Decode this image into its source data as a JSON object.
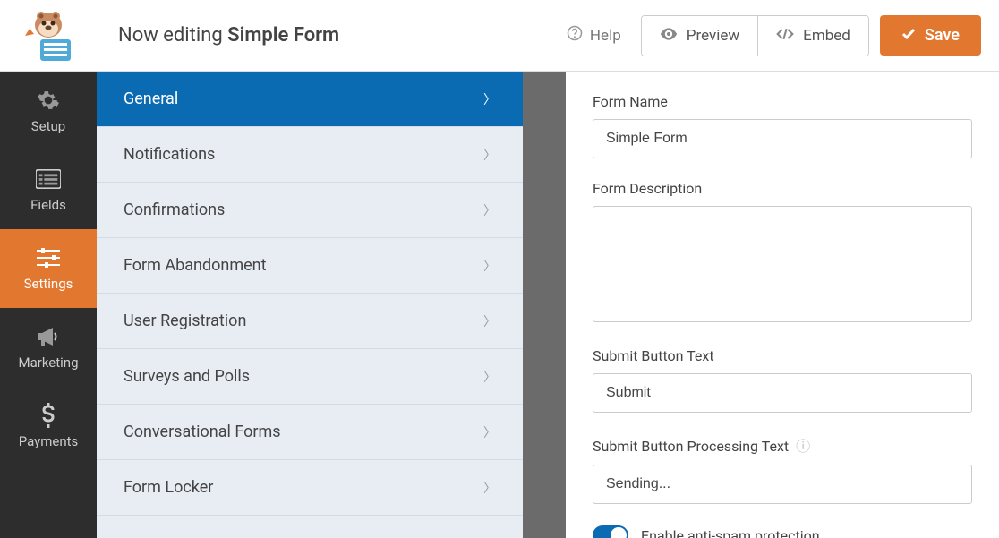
{
  "header": {
    "title_prefix": "Now editing ",
    "form_name": "Simple Form",
    "help": "Help",
    "preview": "Preview",
    "embed": "Embed",
    "save": "Save"
  },
  "sidebar": {
    "items": [
      {
        "label": "Setup",
        "icon": "gear"
      },
      {
        "label": "Fields",
        "icon": "list"
      },
      {
        "label": "Settings",
        "icon": "sliders",
        "active": true
      },
      {
        "label": "Marketing",
        "icon": "bullhorn"
      },
      {
        "label": "Payments",
        "icon": "dollar"
      }
    ]
  },
  "panel": {
    "items": [
      {
        "label": "General",
        "active": true
      },
      {
        "label": "Notifications"
      },
      {
        "label": "Confirmations"
      },
      {
        "label": "Form Abandonment"
      },
      {
        "label": "User Registration"
      },
      {
        "label": "Surveys and Polls"
      },
      {
        "label": "Conversational Forms"
      },
      {
        "label": "Form Locker"
      }
    ]
  },
  "form": {
    "name_label": "Form Name",
    "name_value": "Simple Form",
    "desc_label": "Form Description",
    "desc_value": "",
    "submit_label": "Submit Button Text",
    "submit_value": "Submit",
    "processing_label": "Submit Button Processing Text",
    "processing_value": "Sending...",
    "antispam_label": "Enable anti-spam protection",
    "antispam_on": true
  }
}
